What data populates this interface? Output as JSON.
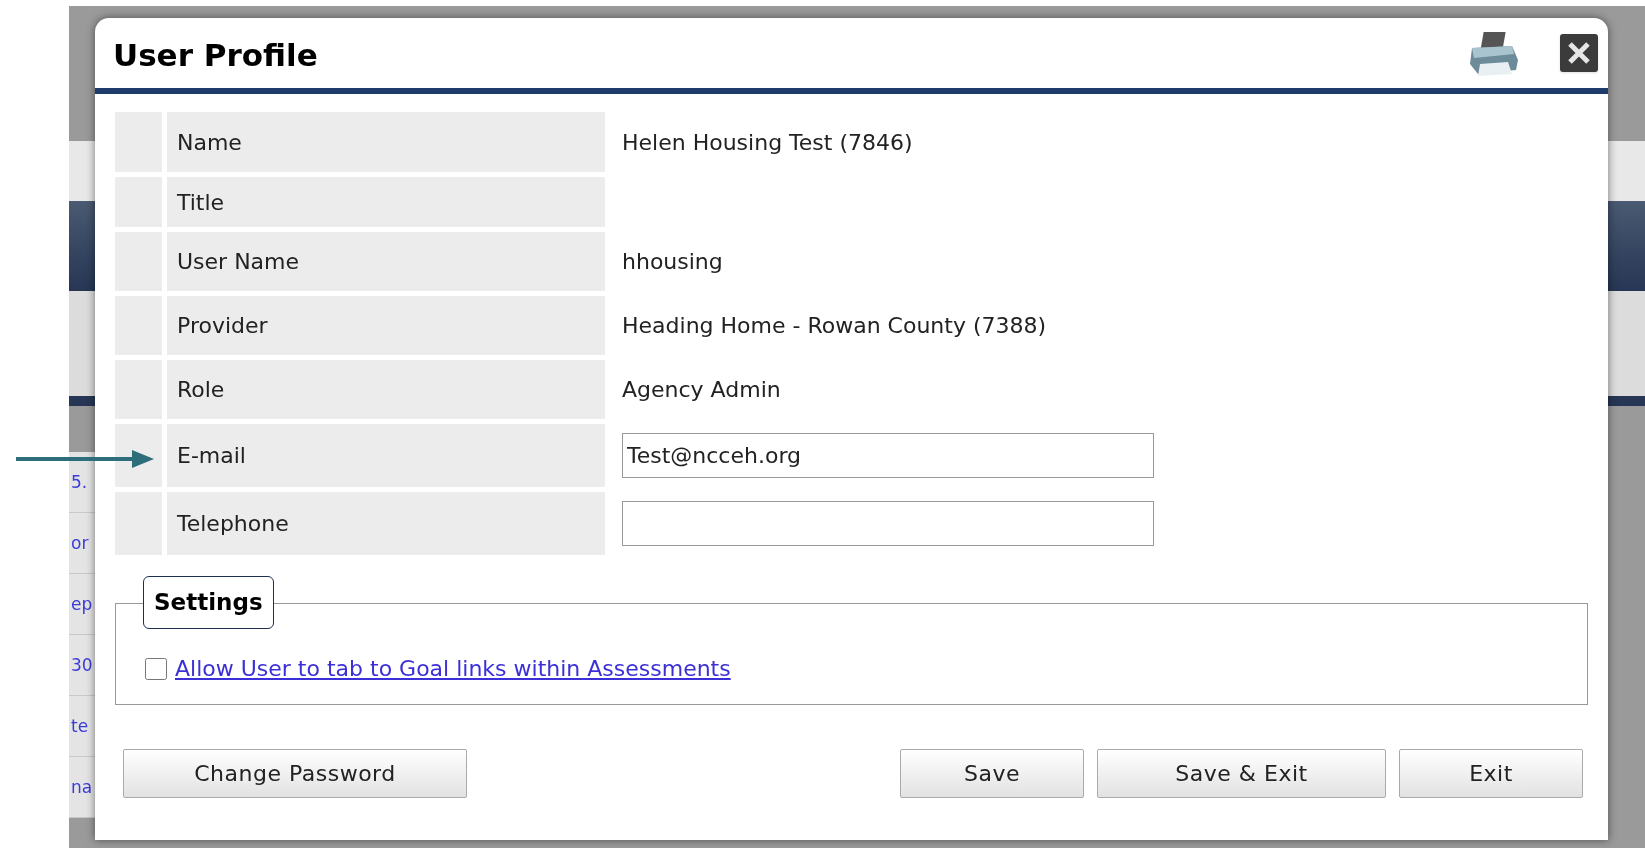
{
  "background": {
    "link_fragments": [
      "5.",
      "or",
      "ep",
      "30",
      "te",
      "na"
    ]
  },
  "dialog": {
    "title": "User Profile",
    "fields": [
      {
        "kind": "text",
        "label": "Name",
        "value": "Helen Housing Test (7846)"
      },
      {
        "kind": "text",
        "label": "Title"
      },
      {
        "kind": "text",
        "label": "User Name",
        "value": "hhousing"
      },
      {
        "kind": "text",
        "label": "Provider",
        "value": "Heading Home - Rowan County (7388)"
      },
      {
        "kind": "text",
        "label": "Role",
        "value": "Agency Admin"
      },
      {
        "kind": "input",
        "label": "E-mail",
        "value": "Test@ncceh.org",
        "pointed": true
      },
      {
        "kind": "input",
        "label": "Telephone"
      }
    ],
    "settings": {
      "legend": "Settings",
      "options": [
        {
          "label": "Allow User to tab to Goal links within Assessments",
          "checked": false
        }
      ]
    },
    "buttons_left": [
      "Change Password"
    ],
    "buttons_right": [
      "Save",
      "Save & Exit",
      "Exit"
    ]
  }
}
